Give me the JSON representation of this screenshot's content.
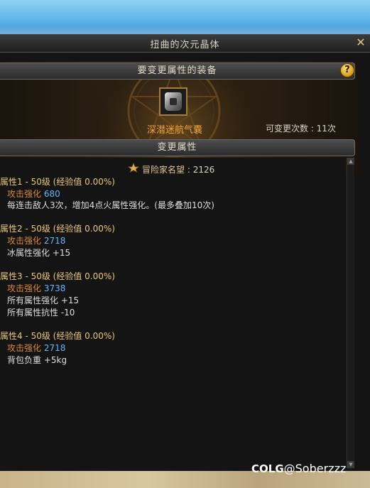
{
  "window": {
    "title": "扭曲的次元晶体"
  },
  "equip_section": {
    "header": "要变更属性的装备",
    "item_name": "深潜迷航气囊",
    "change_count": "可变更次数 : 11次"
  },
  "attr_section": {
    "header": "变更属性",
    "fame_label": "冒险家名望",
    "fame_value": " : 2126",
    "attributes": [
      {
        "title": "属性1 - 50级 (经验值 0.00%)",
        "stat_label": "攻击强化",
        "stat_value": "680",
        "effects": [
          "每连击敌人3次，增加4点火属性强化。(最多叠加10次)"
        ]
      },
      {
        "title": "属性2 - 50级 (经验值 0.00%)",
        "stat_label": "攻击强化",
        "stat_value": "2718",
        "effects": [
          "冰属性强化 +15"
        ]
      },
      {
        "title": "属性3 - 50级 (经验值 0.00%)",
        "stat_label": "攻击强化",
        "stat_value": "3738",
        "effects": [
          "所有属性强化 +15",
          "所有属性抗性 -10"
        ]
      },
      {
        "title": "属性4 - 50级 (经验值 0.00%)",
        "stat_label": "攻击强化",
        "stat_value": "2718",
        "effects": [
          "背包负重 +5kg"
        ]
      }
    ]
  },
  "watermark": {
    "logo": "COLG",
    "handle": "@Soberzzz"
  },
  "icons": [
    "close-icon",
    "help-icon",
    "item-icon",
    "fame-icon",
    "scroll-up-icon",
    "scroll-down-icon"
  ],
  "colors": {
    "title_gold": "#e9c77a",
    "stat_orange": "#d98a3a",
    "value_blue": "#5fb6ff",
    "item_orange": "#f0a23c"
  }
}
